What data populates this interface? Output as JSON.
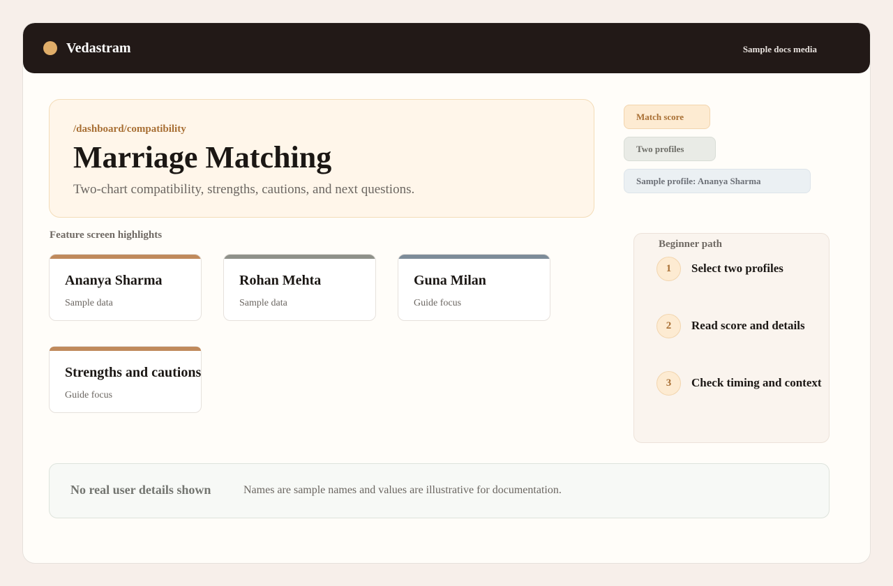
{
  "header": {
    "brand": "Vedastram",
    "right_text": "Sample docs media",
    "accent_color": "#e0ad69"
  },
  "hero": {
    "route": "/dashboard/compatibility",
    "title": "Marriage Matching",
    "subtitle": "Two-chart compatibility, strengths, cautions, and next questions."
  },
  "chips": {
    "score": "Match score",
    "profiles": "Two profiles",
    "sample": "Sample profile: Ananya Sharma"
  },
  "highlights": {
    "label": "Feature screen highlights",
    "cards": [
      {
        "title": "Ananya Sharma",
        "subtitle": "Sample data",
        "color": "#c08a5c"
      },
      {
        "title": "Rohan Mehta",
        "subtitle": "Sample data",
        "color": "#8f918a"
      },
      {
        "title": "Guna Milan",
        "subtitle": "Guide focus",
        "color": "#7d8c99"
      },
      {
        "title": "Strengths and cautions",
        "subtitle": "Guide focus",
        "color": "#c08a5c"
      }
    ]
  },
  "path": {
    "title": "Beginner path",
    "steps": [
      {
        "num": "1",
        "label": "Select two profiles"
      },
      {
        "num": "2",
        "label": "Read score and details"
      },
      {
        "num": "3",
        "label": "Check timing and context"
      }
    ]
  },
  "notice": {
    "title": "No real user details shown",
    "text": "Names are sample names and values are illustrative for documentation."
  }
}
